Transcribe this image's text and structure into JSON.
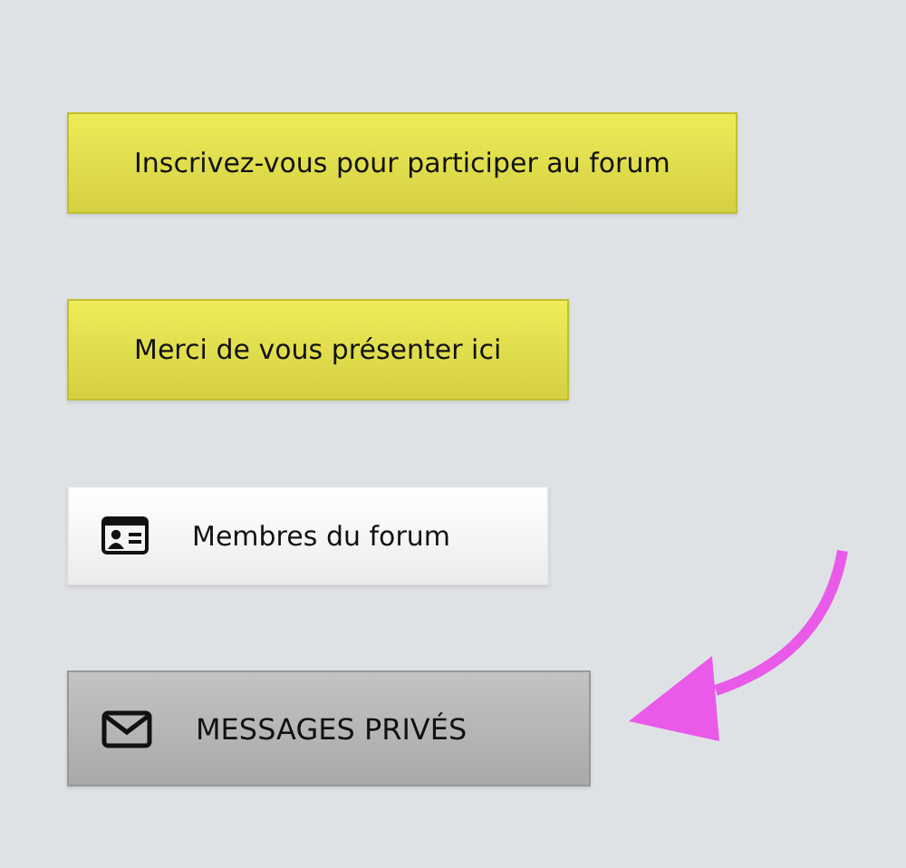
{
  "buttons": [
    {
      "kind": "promo",
      "label": "Inscrivez-vous pour participer au forum"
    },
    {
      "kind": "promo",
      "label": "Merci de vous présenter ici"
    },
    {
      "kind": "members",
      "label": "Membres du forum"
    },
    {
      "kind": "messages",
      "label": "MESSAGES PRIVÉS"
    }
  ]
}
